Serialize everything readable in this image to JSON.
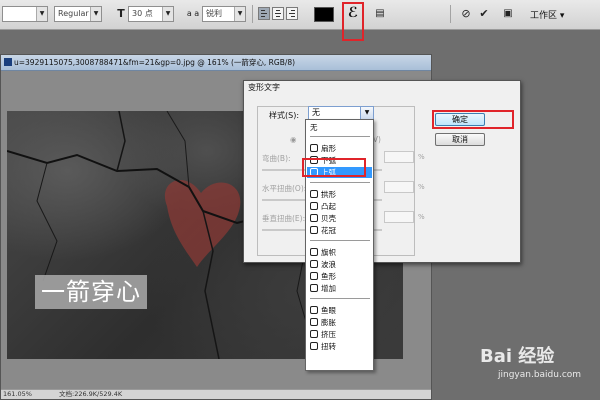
{
  "options_bar": {
    "font_style": "Regular",
    "font_size_icon": "T",
    "font_size": "30 点",
    "aa_icon": "a a",
    "anti_alias": "锐利",
    "warp_icon": "warp-text-icon",
    "workspace": "工作区 ▾"
  },
  "document": {
    "title": "u=3929115075,3008788471&fm=21&gp=0.jpg @ 161% (一箭穿心, RGB/8)",
    "canvas_text": "一箭穿心",
    "zoom": "161.05%",
    "doc_size": "文档:226.9K/529.4K"
  },
  "dialog": {
    "title": "变形文字",
    "style_label": "样式(S):",
    "style_value": "无",
    "orient_h": "◉",
    "orient_v": "(V)",
    "bend_label": "弯曲(B):",
    "hdist_label": "水平扭曲(O):",
    "vdist_label": "垂直扭曲(E):",
    "pct": "%",
    "ok": "确定",
    "cancel": "取消"
  },
  "dropdown": {
    "top_item": "无",
    "groups": [
      [
        {
          "label": "扇形"
        },
        {
          "label": "下弧"
        },
        {
          "label": "上弧"
        }
      ],
      [
        {
          "label": "拱形"
        },
        {
          "label": "凸起"
        },
        {
          "label": "贝壳"
        },
        {
          "label": "花冠"
        }
      ],
      [
        {
          "label": "旗帜"
        },
        {
          "label": "波浪"
        },
        {
          "label": "鱼形"
        },
        {
          "label": "增加"
        }
      ],
      [
        {
          "label": "鱼眼"
        },
        {
          "label": "膨胀"
        },
        {
          "label": "挤压"
        },
        {
          "label": "扭转"
        }
      ]
    ]
  },
  "watermark": {
    "logo": "Bai  经验",
    "url": "jingyan.baidu.com"
  },
  "colors": {
    "highlight": "#e0242a",
    "selection": "#3399ff",
    "text_color": "#000000"
  }
}
